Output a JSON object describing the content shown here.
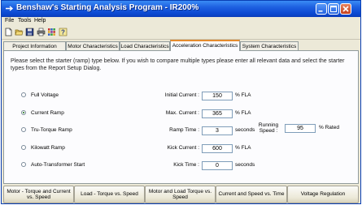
{
  "window": {
    "title": "Benshaw's Starting Analysis Program - IR200%"
  },
  "menu": [
    "File",
    "Tools",
    "Help"
  ],
  "toolbar": {
    "icons": [
      "new-file-icon",
      "open-folder-icon",
      "save-icon",
      "print-icon",
      "grid-icon",
      "help-icon"
    ]
  },
  "tabs": [
    {
      "label": "Project Information",
      "active": false
    },
    {
      "label": "Motor Characteristics",
      "active": false
    },
    {
      "label": "Load Characteristics",
      "active": false
    },
    {
      "label": "Acceleration Characteristics",
      "active": true
    },
    {
      "label": "System Characteristics",
      "active": false
    }
  ],
  "instructions": "Please select the starter (ramp) type below.  If you wish to compare multiple types please enter all relevant data and select the starter types from the Report Setup Dialog.",
  "starter_types": [
    {
      "label": "Full Voltage",
      "checked": false
    },
    {
      "label": "Current Ramp",
      "checked": true
    },
    {
      "label": "Tru-Torque Ramp",
      "checked": false
    },
    {
      "label": "Kilowatt Ramp",
      "checked": false
    },
    {
      "label": "Auto-Transformer Start",
      "checked": false
    }
  ],
  "fields": [
    {
      "label": "Initial Current :",
      "value": "150",
      "unit": "% FLA"
    },
    {
      "label": "Max. Current :",
      "value": "365",
      "unit": "% FLA"
    },
    {
      "label": "Ramp Time :",
      "value": "3",
      "unit": "seconds"
    },
    {
      "label": "Kick Current :",
      "value": "600",
      "unit": "% FLA"
    },
    {
      "label": "Kick Time :",
      "value": "0",
      "unit": "seconds"
    }
  ],
  "running_speed": {
    "label_line1": "Running",
    "label_line2": "Speed :",
    "value": "95",
    "unit": "% Rated"
  },
  "bottom_buttons": [
    "Motor - Torque and Current vs. Speed",
    "Load - Torque vs. Speed",
    "Motor and Load Torque vs. Speed",
    "Current and Speed vs. Time",
    "Voltage Regulation"
  ],
  "colors": {
    "title_bar": "#0b48d1",
    "active_tab_accent": "#e68b2c",
    "panel": "#fcfcfe",
    "chrome": "#ece9d8"
  }
}
